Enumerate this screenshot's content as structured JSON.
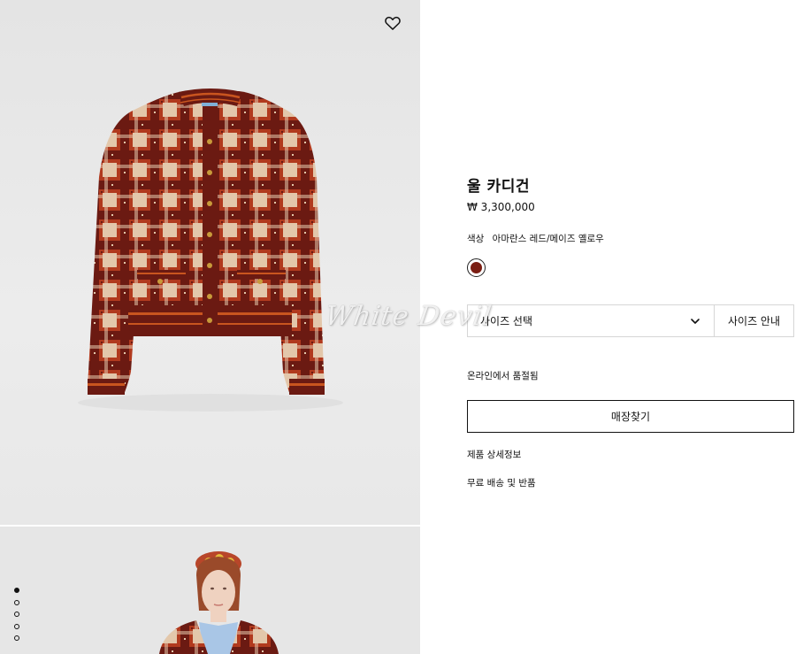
{
  "gallery": {
    "images": [
      {
        "alt": "cardigan-flat-image"
      },
      {
        "alt": "model-image"
      }
    ],
    "active_index": 0,
    "dot_count": 5
  },
  "product": {
    "title": "울 카디건",
    "price": "₩ 3,300,000",
    "color_label": "색상",
    "color_value": "아마란스 레드/메이즈 옐로우",
    "swatch_color": "#7a1d12"
  },
  "size": {
    "select_label": "사이즈 선택",
    "guide_label": "사이즈 안내"
  },
  "availability": {
    "status": "온라인에서 품절됨"
  },
  "actions": {
    "find_store": "매장찾기"
  },
  "links": {
    "details": "제품 상세정보",
    "shipping": "무료 배송 및 반품"
  },
  "watermark": "White Devil",
  "colors": {
    "plaid_dark": "#6b1a12",
    "plaid_red": "#b13a1e",
    "plaid_cream": "#e3c7aa",
    "trim_orange": "#c9551f"
  }
}
